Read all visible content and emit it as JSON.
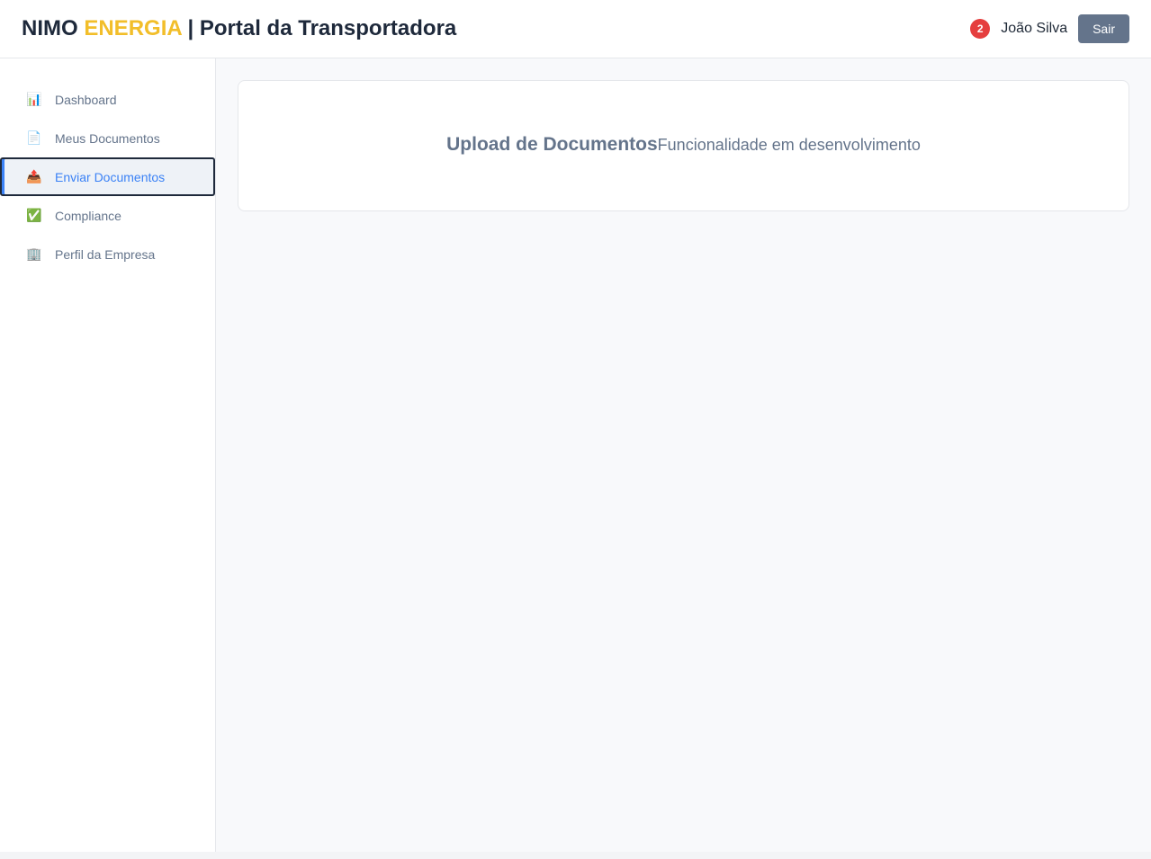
{
  "header": {
    "brand_primary": "NIMO",
    "brand_accent": "ENERGIA",
    "brand_rest": "| Portal da Transportadora",
    "notification_count": "2",
    "user_name": "João Silva",
    "logout_label": "Sair"
  },
  "sidebar": {
    "items": [
      {
        "icon": "bar-chart-icon",
        "glyph": "📊",
        "label": "Dashboard"
      },
      {
        "icon": "document-icon",
        "glyph": "📄",
        "label": "Meus Documentos"
      },
      {
        "icon": "outbox-tray-icon",
        "glyph": "📤",
        "label": "Enviar Documentos",
        "active": true
      },
      {
        "icon": "check-mark-icon",
        "glyph": "✅",
        "label": "Compliance"
      },
      {
        "icon": "office-building-icon",
        "glyph": "🏢",
        "label": "Perfil da Empresa"
      }
    ]
  },
  "main": {
    "card_title": "Upload de Documentos",
    "card_text": "Funcionalidade em desenvolvimento"
  },
  "colors": {
    "accent": "#f2be2a",
    "active_link": "#3b82f6",
    "badge": "#e53e3e",
    "logout_button": "#64748b"
  }
}
